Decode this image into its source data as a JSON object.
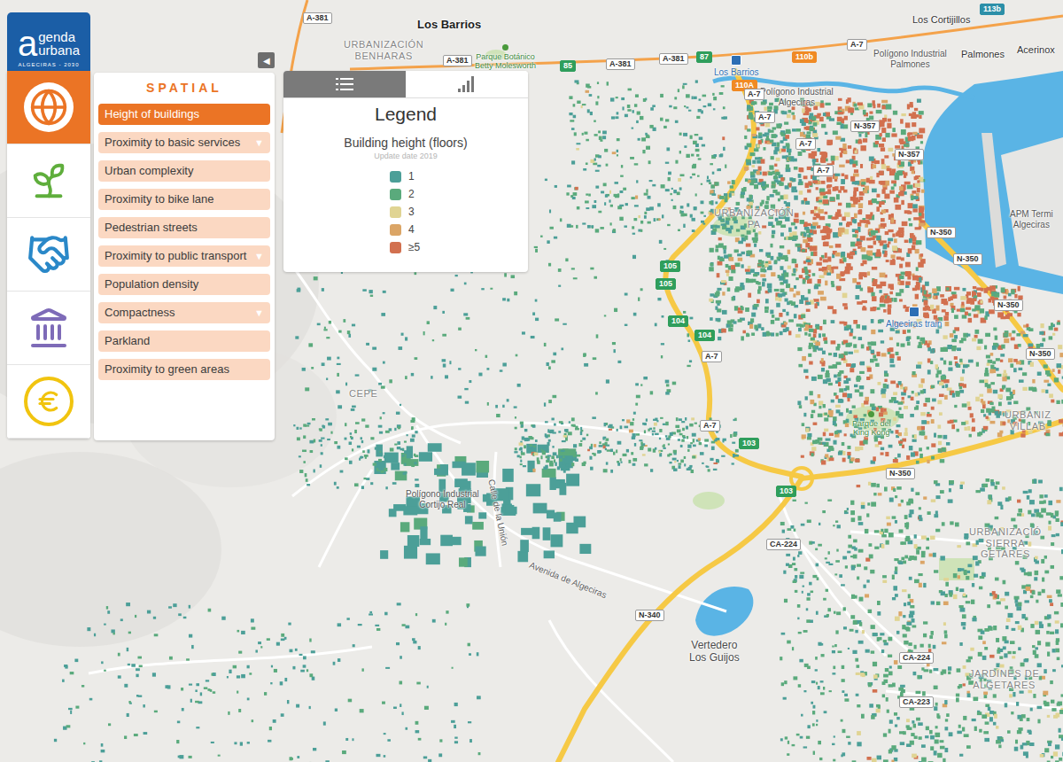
{
  "logo": {
    "initial": "a",
    "word1": "genda",
    "word2": "urbana",
    "subtitle": "ALGECIRAS - 2030"
  },
  "categories": [
    {
      "kind": "spatial",
      "selected": true,
      "color": "#eb7425"
    },
    {
      "kind": "environment",
      "selected": false,
      "color": "#5fae3c"
    },
    {
      "kind": "social",
      "selected": false,
      "color": "#2a88c8"
    },
    {
      "kind": "governance",
      "selected": false,
      "color": "#7e6bb8"
    },
    {
      "kind": "economy",
      "selected": false,
      "color": "#f1c40f"
    }
  ],
  "collapse_button": "◀",
  "panel": {
    "title": "SPATIAL",
    "submenu_glyph": "▼",
    "items": [
      {
        "label": "Height of buildings",
        "selected": true,
        "has_submenu": false
      },
      {
        "label": "Proximity to basic services",
        "selected": false,
        "has_submenu": true
      },
      {
        "label": "Urban complexity",
        "selected": false,
        "has_submenu": false
      },
      {
        "label": "Proximity to bike lane",
        "selected": false,
        "has_submenu": false
      },
      {
        "label": "Pedestrian streets",
        "selected": false,
        "has_submenu": false
      },
      {
        "label": "Proximity to public transport",
        "selected": false,
        "has_submenu": true
      },
      {
        "label": "Population density",
        "selected": false,
        "has_submenu": false
      },
      {
        "label": "Compactness",
        "selected": false,
        "has_submenu": true
      },
      {
        "label": "Parkland",
        "selected": false,
        "has_submenu": false
      },
      {
        "label": "Proximity to green areas",
        "selected": false,
        "has_submenu": false
      }
    ]
  },
  "legend": {
    "tabs": [
      {
        "kind": "list",
        "selected": true
      },
      {
        "kind": "chart",
        "selected": false
      }
    ],
    "title": "Legend",
    "subtitle": "Building height (floors)",
    "update": "Update date 2019",
    "items": [
      {
        "label": "1",
        "color": "#4c9f98"
      },
      {
        "label": "2",
        "color": "#5aaa7c"
      },
      {
        "label": "3",
        "color": "#e0d493"
      },
      {
        "label": "4",
        "color": "#dba566"
      },
      {
        "label": "≥5",
        "color": "#d2704f"
      }
    ]
  },
  "map": {
    "places": [
      {
        "lines": [
          "Los Barrios"
        ],
        "kind": "town"
      },
      {
        "lines": [
          "URBANIZACIÓN",
          "BENHARAS"
        ],
        "kind": "district"
      },
      {
        "lines": [
          "Parque Botánico",
          "Betty Molesworth"
        ],
        "kind": "park"
      },
      {
        "lines": [
          "Los Barrios"
        ],
        "kind": "station"
      },
      {
        "lines": [
          "Los Cortijillos"
        ],
        "kind": "town-small"
      },
      {
        "lines": [
          "Polígono Industrial",
          "Palmones"
        ],
        "kind": "poi"
      },
      {
        "lines": [
          "Palmones"
        ],
        "kind": "town-small"
      },
      {
        "lines": [
          "Acerinox"
        ],
        "kind": "town-small"
      },
      {
        "lines": [
          "Polígono Industrial",
          "Algeciras"
        ],
        "kind": "poi"
      },
      {
        "lines": [
          "APM Termi",
          "Algeciras"
        ],
        "kind": "poi"
      },
      {
        "lines": [
          "URBANIZACIÓN",
          "PA"
        ],
        "kind": "district"
      },
      {
        "lines": [
          "Algeciras train"
        ],
        "kind": "station"
      },
      {
        "lines": [
          "Parque del",
          "King Kong"
        ],
        "kind": "park"
      },
      {
        "lines": [
          "URBANIZ",
          "VILLAB"
        ],
        "kind": "district"
      },
      {
        "lines": [
          "CEPE"
        ],
        "kind": "district"
      },
      {
        "lines": [
          "Polígono Industrial",
          "Cortijo Real"
        ],
        "kind": "poi"
      },
      {
        "lines": [
          "Calle de la Unión"
        ],
        "kind": "street"
      },
      {
        "lines": [
          "Avenida de Algeciras"
        ],
        "kind": "street"
      },
      {
        "lines": [
          "Vertedero",
          "Los Guijos"
        ],
        "kind": "water"
      },
      {
        "lines": [
          "URBANIZACIÓ",
          "SIERRA",
          "GETARES"
        ],
        "kind": "district"
      },
      {
        "lines": [
          "JARDINES DE",
          "ALGETARES"
        ],
        "kind": "district"
      }
    ],
    "road_badges": [
      {
        "text": "A-381",
        "kind": "road"
      },
      {
        "text": "A-381",
        "kind": "road"
      },
      {
        "text": "A-381",
        "kind": "road"
      },
      {
        "text": "85",
        "kind": "exit",
        "color": "#2f9e5c"
      },
      {
        "text": "A-381",
        "kind": "road"
      },
      {
        "text": "87",
        "kind": "exit",
        "color": "#2f9e5c"
      },
      {
        "text": "110b",
        "kind": "exit",
        "color": "#f08a24"
      },
      {
        "text": "A-7",
        "kind": "road"
      },
      {
        "text": "110A",
        "kind": "exit",
        "color": "#f08a24"
      },
      {
        "text": "113b",
        "kind": "exit",
        "color": "#2c8fa8"
      },
      {
        "text": "A-7",
        "kind": "road"
      },
      {
        "text": "A-7",
        "kind": "road"
      },
      {
        "text": "A-7",
        "kind": "road"
      },
      {
        "text": "A-7",
        "kind": "road"
      },
      {
        "text": "N-357",
        "kind": "road"
      },
      {
        "text": "N-357",
        "kind": "road"
      },
      {
        "text": "N-350",
        "kind": "road"
      },
      {
        "text": "N-350",
        "kind": "road"
      },
      {
        "text": "N-350",
        "kind": "road"
      },
      {
        "text": "N-350",
        "kind": "road"
      },
      {
        "text": "105",
        "kind": "exit",
        "color": "#2f9e5c"
      },
      {
        "text": "105",
        "kind": "exit",
        "color": "#2f9e5c"
      },
      {
        "text": "104",
        "kind": "exit",
        "color": "#2f9e5c"
      },
      {
        "text": "104",
        "kind": "exit",
        "color": "#2f9e5c"
      },
      {
        "text": "A-7",
        "kind": "road"
      },
      {
        "text": "A-7",
        "kind": "road"
      },
      {
        "text": "103",
        "kind": "exit",
        "color": "#2f9e5c"
      },
      {
        "text": "103",
        "kind": "exit",
        "color": "#2f9e5c"
      },
      {
        "text": "N-350",
        "kind": "road"
      },
      {
        "text": "CA-224",
        "kind": "road"
      },
      {
        "text": "N-340",
        "kind": "road"
      },
      {
        "text": "CA-224",
        "kind": "road"
      },
      {
        "text": "CA-223",
        "kind": "road"
      }
    ]
  }
}
